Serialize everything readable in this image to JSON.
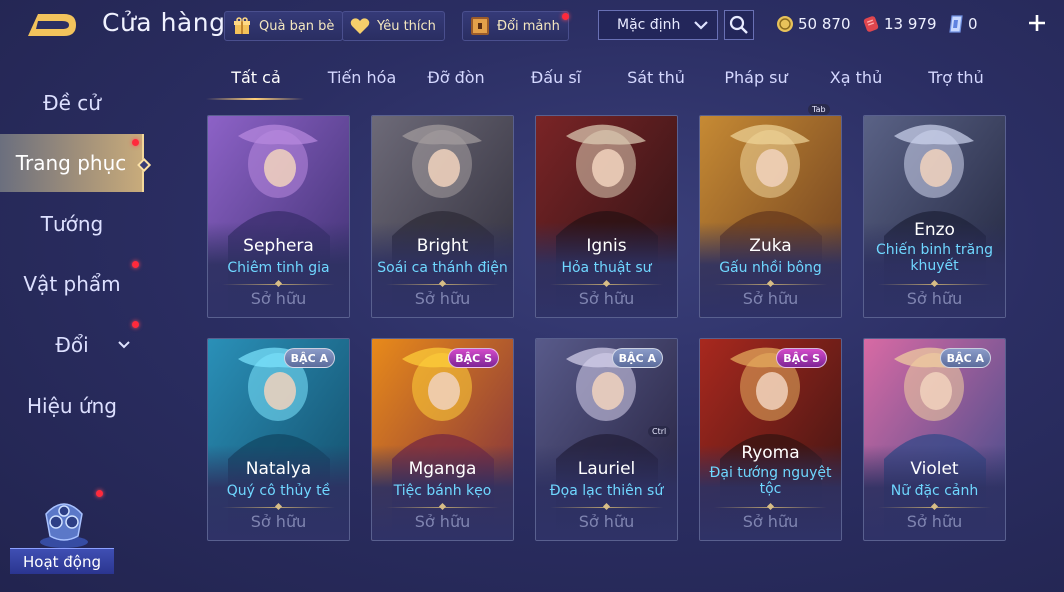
{
  "header": {
    "title": "Cửa hàng",
    "buttons": [
      {
        "label": "Quà bạn bè",
        "icon": "gift-icon"
      },
      {
        "label": "Yêu thích",
        "icon": "heart-icon"
      },
      {
        "label": "Đổi mảnh",
        "icon": "treasure-chest-icon"
      }
    ],
    "sort_value": "Mặc định",
    "currencies": [
      {
        "value": "50 870",
        "icon": "gold-coin-icon",
        "color": "#e8c25a"
      },
      {
        "value": "13 979",
        "icon": "red-voucher-icon",
        "color": "#e0464e"
      },
      {
        "value": "0",
        "icon": "blue-gem-icon",
        "color": "#8fb4ff"
      }
    ]
  },
  "tabs": [
    "Tất cả",
    "Tiến hóa",
    "Đỡ đòn",
    "Đấu sĩ",
    "Sát thủ",
    "Pháp sư",
    "Xạ thủ",
    "Trợ thủ"
  ],
  "active_tab": "Tất cả",
  "hints": {
    "tab": "Tab",
    "ctrl": "Ctrl"
  },
  "sidebar": {
    "items": [
      {
        "label": "Đề cử"
      },
      {
        "label": "Trang phục"
      },
      {
        "label": "Tướng"
      },
      {
        "label": "Vật phẩm"
      },
      {
        "label": "Đổi"
      },
      {
        "label": "Hiệu ứng"
      }
    ],
    "activity_label": "Hoạt động"
  },
  "cards": [
    {
      "hero": "Sephera",
      "skin": "Chiêm tinh gia",
      "status": "Sở hữu",
      "badge": "",
      "palette": [
        "#8d62c7",
        "#3c2f6f",
        "#b98ae0"
      ]
    },
    {
      "hero": "Bright",
      "skin": "Soái ca thánh điện",
      "status": "Sở hữu",
      "badge": "",
      "palette": [
        "#6d6a78",
        "#2f2d3a",
        "#a59ea0"
      ]
    },
    {
      "hero": "Ignis",
      "skin": "Hỏa thuật sư",
      "status": "Sở hữu",
      "badge": "",
      "palette": [
        "#7a2426",
        "#2a1214",
        "#e0d0b8"
      ]
    },
    {
      "hero": "Zuka",
      "skin": "Gấu nhồi bông",
      "status": "Sở hữu",
      "badge": "",
      "palette": [
        "#c68a34",
        "#6a3c1e",
        "#f0d59a"
      ]
    },
    {
      "hero": "Enzo",
      "skin": "Chiến binh trăng khuyết",
      "status": "Sở hữu",
      "badge": "",
      "palette": [
        "#5a6286",
        "#20243c",
        "#cfd6ef"
      ]
    },
    {
      "hero": "Natalya",
      "skin": "Quý cô thủy tề",
      "status": "Sở hữu",
      "badge": "BẬC A",
      "palette": [
        "#2a90b8",
        "#124a66",
        "#7ee6ff"
      ]
    },
    {
      "hero": "Mganga",
      "skin": "Tiệc bánh kẹo",
      "status": "Sở hữu",
      "badge": "BẬC S",
      "palette": [
        "#e88a1a",
        "#7a2a40",
        "#ffd23a"
      ]
    },
    {
      "hero": "Lauriel",
      "skin": "Đọa lạc thiên sứ",
      "status": "Sở hữu",
      "badge": "BẬC A",
      "palette": [
        "#585a8a",
        "#24203c",
        "#d8d4ee"
      ]
    },
    {
      "hero": "Ryoma",
      "skin": "Đại tướng nguyệt tộc",
      "status": "Sở hữu",
      "badge": "BẬC S",
      "palette": [
        "#a8281e",
        "#3a1412",
        "#e8b060"
      ]
    },
    {
      "hero": "Violet",
      "skin": "Nữ đặc cảnh",
      "status": "Sở hữu",
      "badge": "BẬC A",
      "palette": [
        "#d86aa4",
        "#3a4a8a",
        "#f2d2a0"
      ]
    }
  ]
}
